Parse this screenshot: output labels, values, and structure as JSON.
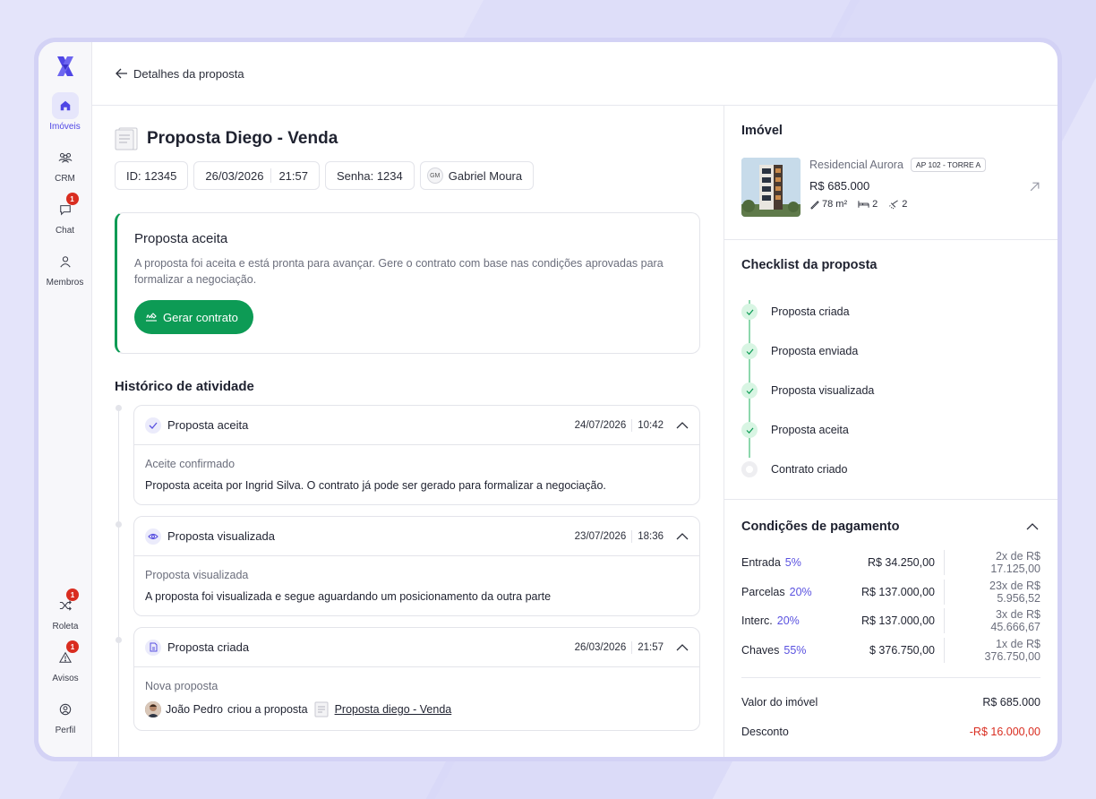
{
  "nav": {
    "items": [
      {
        "label": "Imóveis"
      },
      {
        "label": "CRM"
      },
      {
        "label": "Chat",
        "badge": "1"
      },
      {
        "label": "Membros"
      }
    ],
    "bottom": [
      {
        "label": "Roleta",
        "badge": "1"
      },
      {
        "label": "Avisos",
        "badge": "1"
      },
      {
        "label": "Perfil"
      }
    ]
  },
  "header": {
    "back_label": "Detalhes da proposta"
  },
  "proposal": {
    "title": "Proposta Diego - Venda",
    "id": "ID: 12345",
    "date": "26/03/2026",
    "time": "21:57",
    "password": "Senha: 1234",
    "agent_initials": "GM",
    "agent_name": "Gabriel Moura"
  },
  "accepted": {
    "title": "Proposta aceita",
    "text": "A proposta foi aceita e está pronta para avançar. Gere o contrato com base nas condições aprovadas para formalizar a negociação.",
    "button": "Gerar contrato"
  },
  "history": {
    "title": "Histórico de atividade",
    "items": [
      {
        "title": "Proposta aceita",
        "date": "24/07/2026",
        "time": "10:42",
        "subtitle": "Aceite confirmado",
        "text": "Proposta aceita por Ingrid Silva. O contrato já pode ser gerado para formalizar a negociação."
      },
      {
        "title": "Proposta visualizada",
        "date": "23/07/2026",
        "time": "18:36",
        "subtitle": "Proposta visualizada",
        "text": "A proposta foi visualizada e segue aguardando um posicionamento da outra parte"
      },
      {
        "title": "Proposta criada",
        "date": "26/03/2026",
        "time": "21:57",
        "subtitle": "Nova proposta",
        "user": "João Pedro",
        "action": "criou a proposta",
        "link": "Proposta diego - Venda"
      }
    ]
  },
  "property": {
    "section_title": "Imóvel",
    "name": "Residencial Aurora",
    "tag": "AP 102 - TORRE A",
    "price": "R$ 685.000",
    "area": "78 m²",
    "beds": "2",
    "baths": "2"
  },
  "checklist": {
    "title": "Checklist da proposta",
    "items": [
      {
        "label": "Proposta criada"
      },
      {
        "label": "Proposta enviada"
      },
      {
        "label": "Proposta visualizada"
      },
      {
        "label": "Proposta aceita"
      },
      {
        "label": "Contrato criado"
      }
    ]
  },
  "payment": {
    "title": "Condições de pagamento",
    "rows": [
      {
        "label": "Entrada",
        "pct": "5%",
        "value": "R$ 34.250,00",
        "inst": "2x de R$ 17.125,00"
      },
      {
        "label": "Parcelas",
        "pct": "20%",
        "value": "R$ 137.000,00",
        "inst": "23x de R$ 5.956,52"
      },
      {
        "label": "Interc.",
        "pct": "20%",
        "value": "R$ 137.000,00",
        "inst": "3x de R$ 45.666,67"
      },
      {
        "label": "Chaves",
        "pct": "55%",
        "value": "$ 376.750,00",
        "inst": "1x de R$ 376.750,00"
      }
    ],
    "property_value_label": "Valor do imóvel",
    "property_value": "R$ 685.000",
    "discount_label": "Desconto",
    "discount": "-R$ 16.000,00"
  },
  "colors": {
    "accent": "#4f46e5",
    "success": "#0d9b55",
    "danger": "#d92d20"
  }
}
